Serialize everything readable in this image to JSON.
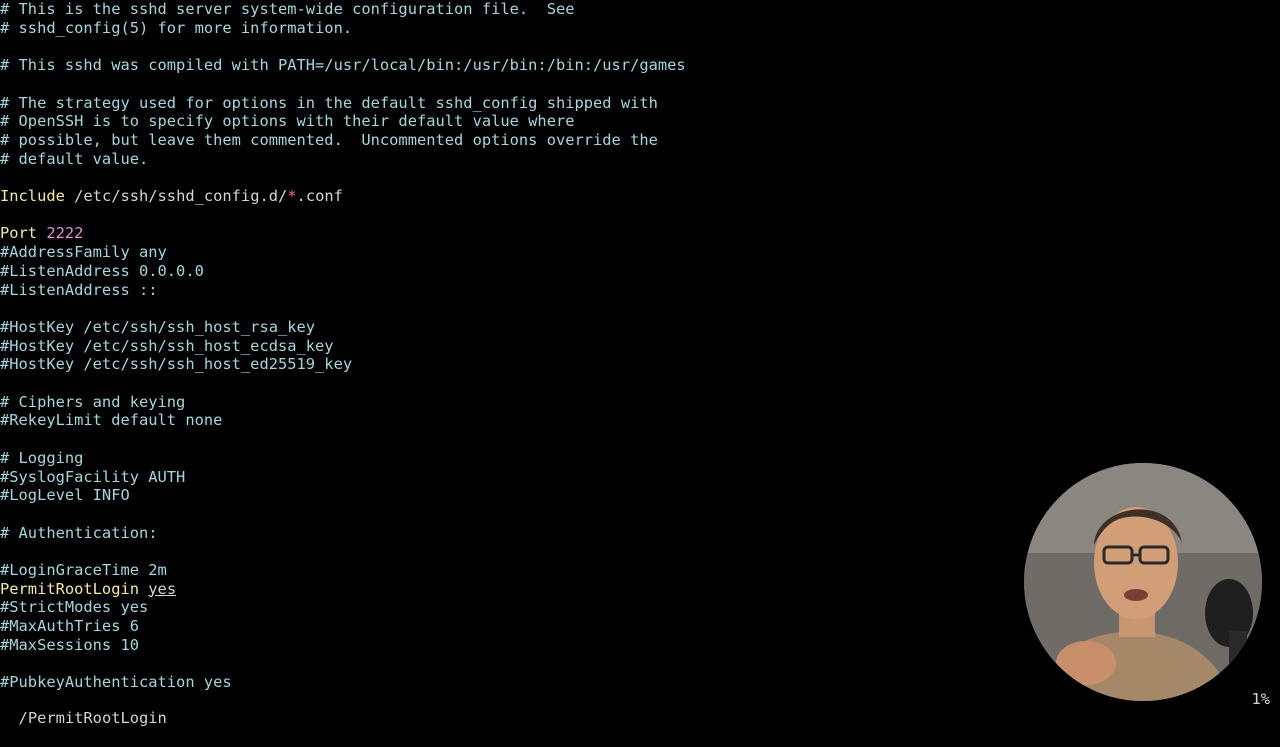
{
  "editor": {
    "lines": [
      {
        "type": "comment",
        "text": "# This is the sshd server system-wide configuration file.  See"
      },
      {
        "type": "comment",
        "text": "# sshd_config(5) for more information."
      },
      {
        "type": "blank",
        "text": ""
      },
      {
        "type": "comment",
        "text": "# This sshd was compiled with PATH=/usr/local/bin:/usr/bin:/bin:/usr/games"
      },
      {
        "type": "blank",
        "text": ""
      },
      {
        "type": "comment",
        "text": "# The strategy used for options in the default sshd_config shipped with"
      },
      {
        "type": "comment",
        "text": "# OpenSSH is to specify options with their default value where"
      },
      {
        "type": "comment",
        "text": "# possible, but leave them commented.  Uncommented options override the"
      },
      {
        "type": "comment",
        "text": "# default value."
      },
      {
        "type": "blank",
        "text": ""
      },
      {
        "type": "include",
        "keyword": "Include",
        "path_pre": " /etc/ssh/sshd_config.d/",
        "glob": "*",
        "path_post": ".conf"
      },
      {
        "type": "blank",
        "text": ""
      },
      {
        "type": "setting",
        "keyword": "Port",
        "value": " 2222"
      },
      {
        "type": "comment",
        "text": "#AddressFamily any"
      },
      {
        "type": "comment",
        "text": "#ListenAddress 0.0.0.0"
      },
      {
        "type": "comment",
        "text": "#ListenAddress ::"
      },
      {
        "type": "blank",
        "text": ""
      },
      {
        "type": "comment",
        "text": "#HostKey /etc/ssh/ssh_host_rsa_key"
      },
      {
        "type": "comment",
        "text": "#HostKey /etc/ssh/ssh_host_ecdsa_key"
      },
      {
        "type": "comment",
        "text": "#HostKey /etc/ssh/ssh_host_ed25519_key"
      },
      {
        "type": "blank",
        "text": ""
      },
      {
        "type": "comment",
        "text": "# Ciphers and keying"
      },
      {
        "type": "comment",
        "text": "#RekeyLimit default none"
      },
      {
        "type": "blank",
        "text": ""
      },
      {
        "type": "comment",
        "text": "# Logging"
      },
      {
        "type": "comment",
        "text": "#SyslogFacility AUTH"
      },
      {
        "type": "comment",
        "text": "#LogLevel INFO"
      },
      {
        "type": "blank",
        "text": ""
      },
      {
        "type": "comment",
        "text": "# Authentication:"
      },
      {
        "type": "blank",
        "text": ""
      },
      {
        "type": "comment",
        "text": "#LoginGraceTime 2m"
      },
      {
        "type": "setting-u",
        "keyword": "PermitRootLogin",
        "space": " ",
        "value": "yes"
      },
      {
        "type": "comment",
        "text": "#StrictModes yes"
      },
      {
        "type": "comment",
        "text": "#MaxAuthTries 6"
      },
      {
        "type": "comment",
        "text": "#MaxSessions 10"
      },
      {
        "type": "blank",
        "text": ""
      },
      {
        "type": "comment",
        "text": "#PubkeyAuthentication yes"
      }
    ]
  },
  "status": {
    "search_command": "/PermitRootLogin",
    "scroll_percent": "1%"
  },
  "colors": {
    "background": "#000000",
    "comment": "#9fd8df",
    "keyword": "#f3ec94",
    "number": "#e48fe0",
    "glob": "#ff6a6a"
  }
}
